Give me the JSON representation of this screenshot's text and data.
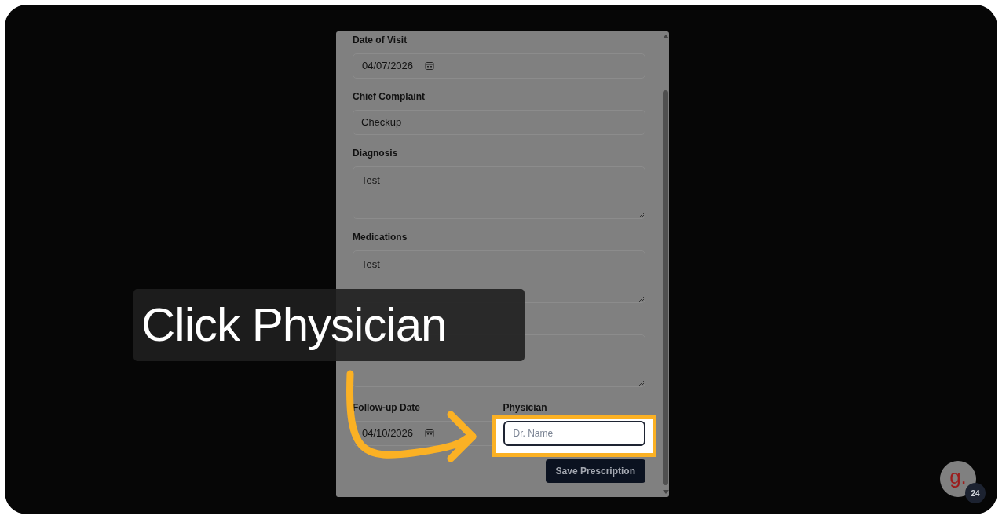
{
  "modal": {
    "fields": [
      {
        "kind": "date",
        "label": "Date of Visit",
        "value": "04/07/2026"
      },
      {
        "kind": "text",
        "label": "Chief Complaint",
        "value": "Checkup"
      },
      {
        "kind": "textarea",
        "label": "Diagnosis",
        "value": "Test"
      },
      {
        "kind": "textarea",
        "label": "Medications",
        "value": "Test"
      },
      {
        "kind": "textarea"
      }
    ],
    "row": [
      {
        "kind": "date",
        "label": "Follow-up Date",
        "value": "04/10/2026"
      },
      {
        "kind": "text",
        "label": "Physician",
        "placeholder": "Dr. Name",
        "highlighted": true
      }
    ],
    "button": "Save Prescription"
  },
  "caption": "Click Physician",
  "chat_badge": {
    "letter": "g.",
    "count": "24"
  }
}
